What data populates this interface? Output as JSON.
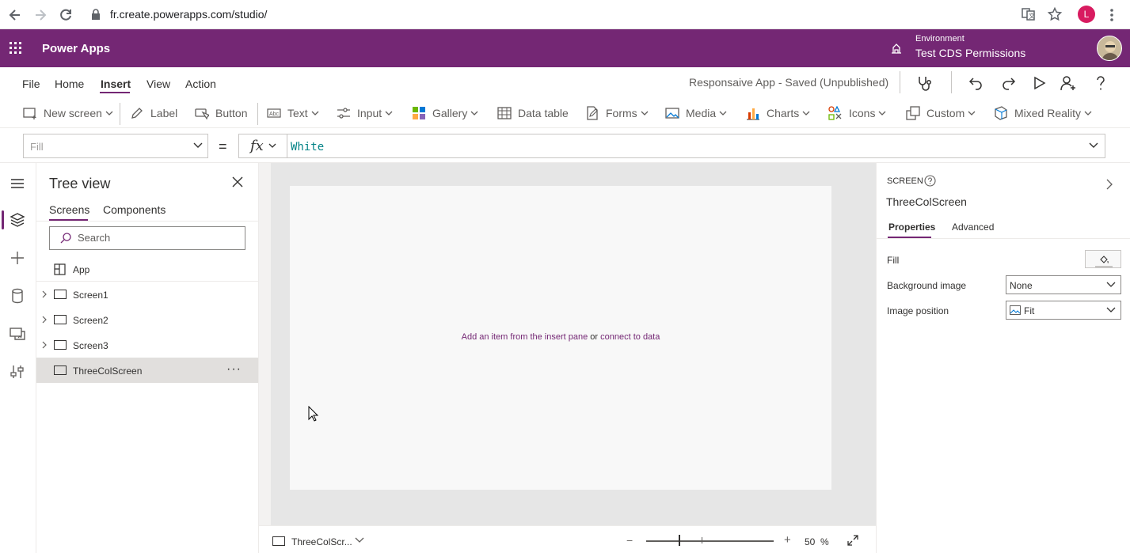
{
  "browser": {
    "url": "fr.create.powerapps.com/studio/",
    "profile_initial": "L"
  },
  "header": {
    "app_name": "Power Apps",
    "environment_label": "Environment",
    "environment_name": "Test CDS Permissions"
  },
  "menu": {
    "items": [
      "File",
      "Home",
      "Insert",
      "View",
      "Action"
    ],
    "active": "Insert",
    "status": "Responsaive App - Saved (Unpublished)"
  },
  "ribbon": {
    "new_screen": "New screen",
    "label": "Label",
    "button": "Button",
    "text": "Text",
    "input": "Input",
    "gallery": "Gallery",
    "data_table": "Data table",
    "forms": "Forms",
    "media": "Media",
    "charts": "Charts",
    "icons": "Icons",
    "custom": "Custom",
    "mixed_reality": "Mixed Reality"
  },
  "formula": {
    "property": "Fill",
    "equals": "=",
    "fx": "fx",
    "value": "White"
  },
  "tree_view": {
    "title": "Tree view",
    "tabs": [
      "Screens",
      "Components"
    ],
    "active_tab": "Screens",
    "search_placeholder": "Search",
    "app_label": "App",
    "screens": [
      "Screen1",
      "Screen2",
      "Screen3",
      "ThreeColScreen"
    ],
    "selected": "ThreeColScreen",
    "more": "···"
  },
  "canvas": {
    "hint_insert": "Add an item from the insert pane",
    "hint_or": "or",
    "hint_connect": "connect to data"
  },
  "status_bar": {
    "screen_name": "ThreeColScr...",
    "minus": "−",
    "plus": "+",
    "zoom": "50",
    "zoom_unit": "%",
    "zoom_fraction": 0.5
  },
  "properties": {
    "kind": "SCREEN",
    "name": "ThreeColScreen",
    "tabs": [
      "Properties",
      "Advanced"
    ],
    "active_tab": "Properties",
    "fill_label": "Fill",
    "background_image_label": "Background image",
    "background_image_value": "None",
    "image_position_label": "Image position",
    "image_position_value": "Fit"
  },
  "colors": {
    "brand": "#742774",
    "formula_text": "#038387"
  }
}
